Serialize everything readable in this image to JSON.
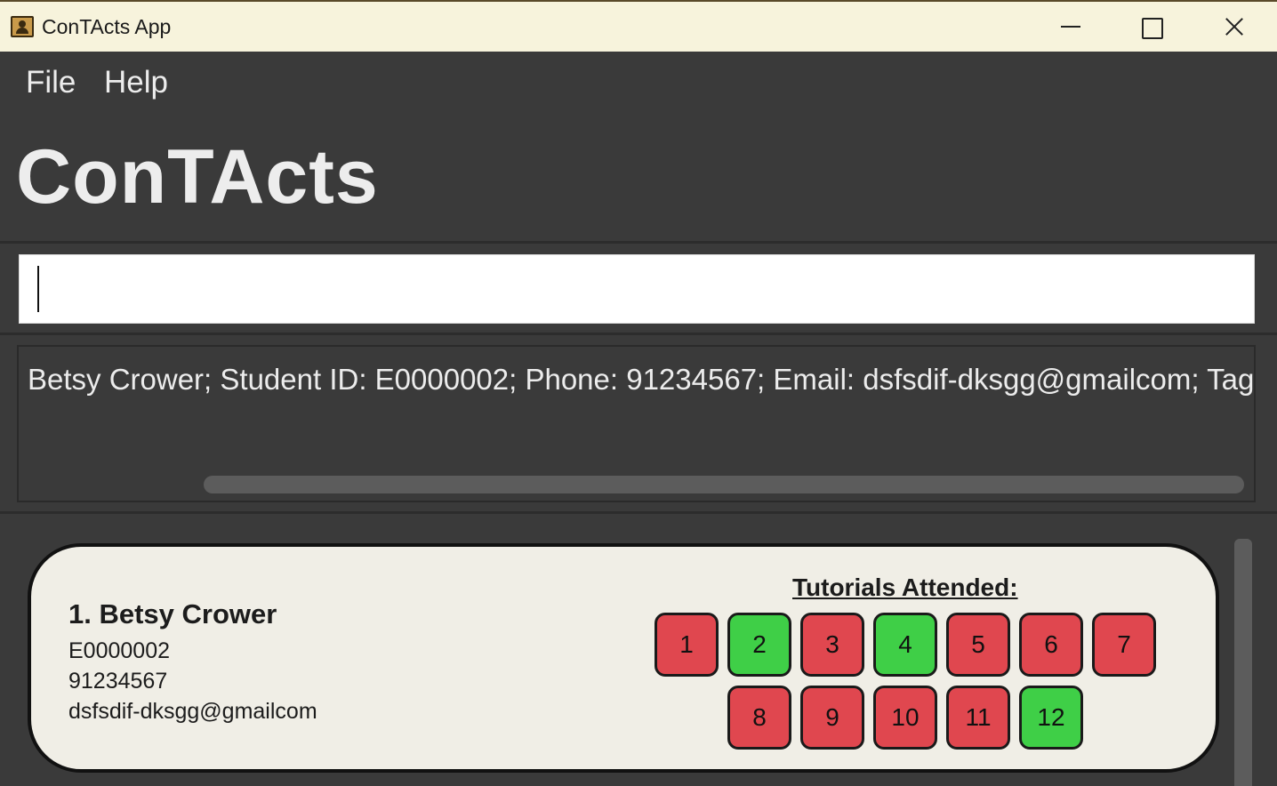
{
  "window": {
    "title": "ConTActs App"
  },
  "menu": {
    "file": "File",
    "help": "Help"
  },
  "app": {
    "title": "ConTActs"
  },
  "command": {
    "value": ""
  },
  "result": {
    "text": "Betsy Crower; Student ID: E0000002; Phone: 91234567; Email: dsfsdif-dksgg@gmailcom; Tags:"
  },
  "contact": {
    "name": "1. Betsy Crower",
    "student_id": "E0000002",
    "phone": "91234567",
    "email": "dsfsdif-dksgg@gmailcom",
    "tutorials_heading": "Tutorials Attended:",
    "tutorials": [
      {
        "label": "1",
        "attended": false
      },
      {
        "label": "2",
        "attended": true
      },
      {
        "label": "3",
        "attended": false
      },
      {
        "label": "4",
        "attended": true
      },
      {
        "label": "5",
        "attended": false
      },
      {
        "label": "6",
        "attended": false
      },
      {
        "label": "7",
        "attended": false
      },
      {
        "label": "8",
        "attended": false
      },
      {
        "label": "9",
        "attended": false
      },
      {
        "label": "10",
        "attended": false
      },
      {
        "label": "11",
        "attended": false
      },
      {
        "label": "12",
        "attended": true
      }
    ]
  },
  "colors": {
    "attended": "#3fcf47",
    "absent": "#e0474f"
  }
}
